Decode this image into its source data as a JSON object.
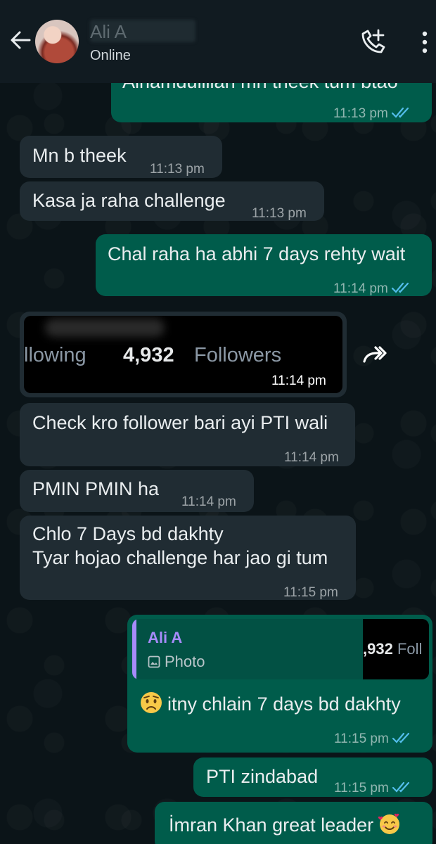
{
  "header": {
    "contact_name": "Ali A",
    "status": "Online"
  },
  "messages": [
    {
      "dir": "out",
      "text": "Alhamdulillah mn theek tum btao",
      "time": "11:13 pm",
      "read": true
    },
    {
      "dir": "in",
      "text": "Mn b theek",
      "time": "11:13 pm"
    },
    {
      "dir": "in",
      "text": "Kasa ja raha challenge",
      "time": "11:13 pm"
    },
    {
      "dir": "out",
      "text": "Chal raha ha abhi 7 days rehty wait",
      "time": "11:14 pm",
      "read": true
    },
    {
      "dir": "in",
      "type": "image",
      "image_text_following": "llowing",
      "image_text_count": "4,932",
      "image_text_followers": "Followers",
      "time": "11:14 pm"
    },
    {
      "dir": "in",
      "text": "Check kro follower bari ayi PTI wali",
      "time": "11:14 pm"
    },
    {
      "dir": "in",
      "text": "PMIN PMIN ha",
      "time": "11:14 pm"
    },
    {
      "dir": "in",
      "lines": [
        "Chlo 7 Days bd dakhty",
        "Tyar hojao challenge har jao gi tum"
      ],
      "time": "11:15 pm"
    },
    {
      "dir": "out",
      "reply_to": {
        "name": "Ali A",
        "type": "Photo",
        "thumb_count": ",932",
        "thumb_text": "Foll"
      },
      "text": "itny chlain 7 days bd dakhty",
      "emoji": "worried-face",
      "time": "11:15 pm",
      "read": true
    },
    {
      "dir": "out",
      "text": "PTI zindabad",
      "time": "11:15 pm",
      "read": true
    },
    {
      "dir": "out",
      "text": "İmran Khan great leader",
      "emoji": "smiling-face-with-hearts",
      "time": "",
      "read": false
    }
  ],
  "colors": {
    "background": "#0b1418",
    "header": "#111b21",
    "incoming_bubble": "#202c33",
    "outgoing_bubble": "#005c4b",
    "read_ticks": "#53bdeb",
    "quote_name": "#a78bfa"
  },
  "icons": {
    "back": "back-arrow-icon",
    "call": "add-call-icon",
    "menu": "more-vertical-icon",
    "forward": "forward-icon",
    "photo": "photo-icon"
  }
}
